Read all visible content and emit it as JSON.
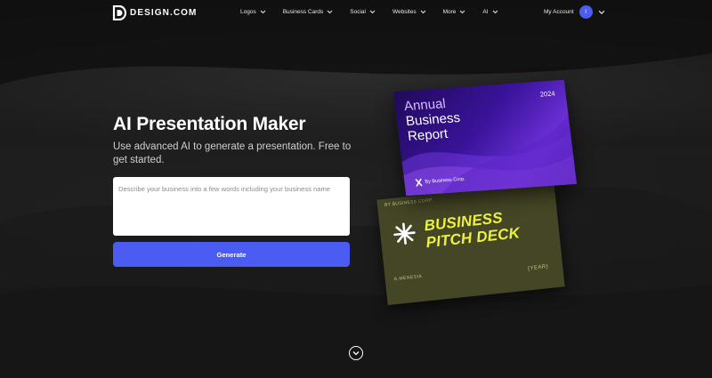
{
  "brand": {
    "name": "DESIGN.COM"
  },
  "nav": {
    "items": [
      {
        "label": "Logos",
        "icon": "chevron-down-icon"
      },
      {
        "label": "Business Cards",
        "icon": "chevron-down-icon"
      },
      {
        "label": "Social",
        "icon": "chevron-down-icon"
      },
      {
        "label": "Websites",
        "icon": "chevron-down-icon"
      },
      {
        "label": "More",
        "icon": "chevron-down-icon"
      },
      {
        "label": "AI",
        "icon": "chevron-down-icon"
      }
    ],
    "account_label": "My Account",
    "avatar_initial": "I"
  },
  "hero": {
    "title": "AI Presentation Maker",
    "subtitle": "Use advanced AI to generate a presentation. Free to get started.",
    "prompt_placeholder": "Describe your business into a few words including your business name",
    "generate_label": "Generate"
  },
  "preview": {
    "front_card": {
      "line1": "Annual",
      "line2": "Business",
      "line3": "Report",
      "year": "2024",
      "company": "By Business Corp."
    },
    "back_card": {
      "meta": "BY BUSINESS CORP.",
      "line1": "BUSINESS",
      "line2": "PITCH DECK",
      "name": "A.MENESIA",
      "year": "{YEAR}"
    }
  },
  "colors": {
    "accent": "#4b5cf2",
    "background": "#161616",
    "pitch_card": "#454625",
    "pitch_text": "#ecf23b",
    "report_card": "#3a139b"
  },
  "icons": {
    "scroll": "chevron-down-circle-icon"
  }
}
